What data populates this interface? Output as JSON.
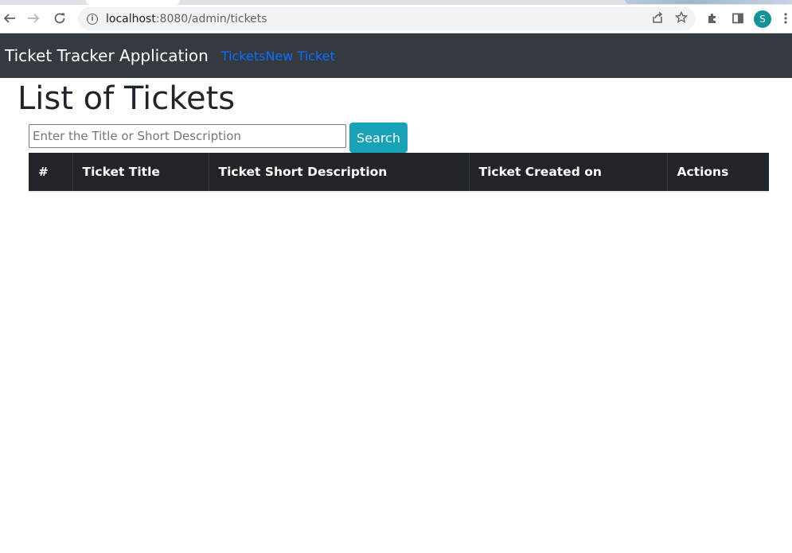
{
  "browser": {
    "url_host": "localhost",
    "url_rest": ":8080/admin/tickets",
    "profile_initial": "S",
    "icons": [
      "back-arrow-icon",
      "forward-arrow-icon",
      "reload-icon",
      "info-icon",
      "share-icon",
      "star-icon",
      "extensions-icon",
      "side-panel-icon",
      "more-vert-icon"
    ]
  },
  "navbar": {
    "brand": "Ticket Tracker Application",
    "links": [
      "Tickets",
      "New Ticket"
    ],
    "colors": {
      "background": "#343a40",
      "link": "#0d6efd"
    }
  },
  "page": {
    "title": "List of Tickets"
  },
  "search": {
    "placeholder": "Enter the Title or Short Description",
    "value": "",
    "button_label": "Search",
    "button_color": "#17a2b8"
  },
  "table": {
    "headers": [
      "#",
      "Ticket Title",
      "Ticket Short Description",
      "Ticket Created on",
      "Actions"
    ],
    "rows": [],
    "header_color": "#212529"
  }
}
